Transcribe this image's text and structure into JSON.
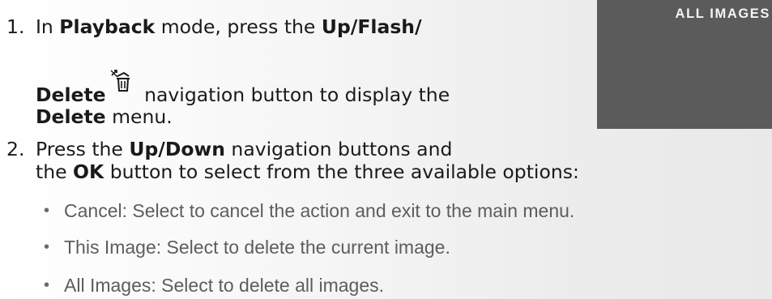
{
  "step1": {
    "number": "1.",
    "pre": "In ",
    "mode": "Playback",
    "mid": " mode, press the ",
    "button_line1": "Up/Flash/",
    "button_line2": "Delete",
    "icon": "flash-off-trash-icon",
    "after_icon": " navigation button to display the",
    "menu": "Delete",
    "end": " menu."
  },
  "step2": {
    "number": "2.",
    "pre": "Press the ",
    "buttons": "Up/Down",
    "post": " navigation buttons and",
    "line2_pre": "the ",
    "ok": "OK",
    "line2_post": " button to select from the three available options:",
    "options": [
      {
        "bullet": "•",
        "text": "Cancel: Select to cancel the action and exit to the main menu."
      },
      {
        "bullet": "•",
        "text": "This Image: Select to delete the current image."
      },
      {
        "bullet": "•",
        "text": "All Images: Select to delete all images."
      }
    ]
  },
  "screen": {
    "label": "ALL IMAGES",
    "background": "#5b5b5b",
    "text_color": "#f4f4f4"
  }
}
